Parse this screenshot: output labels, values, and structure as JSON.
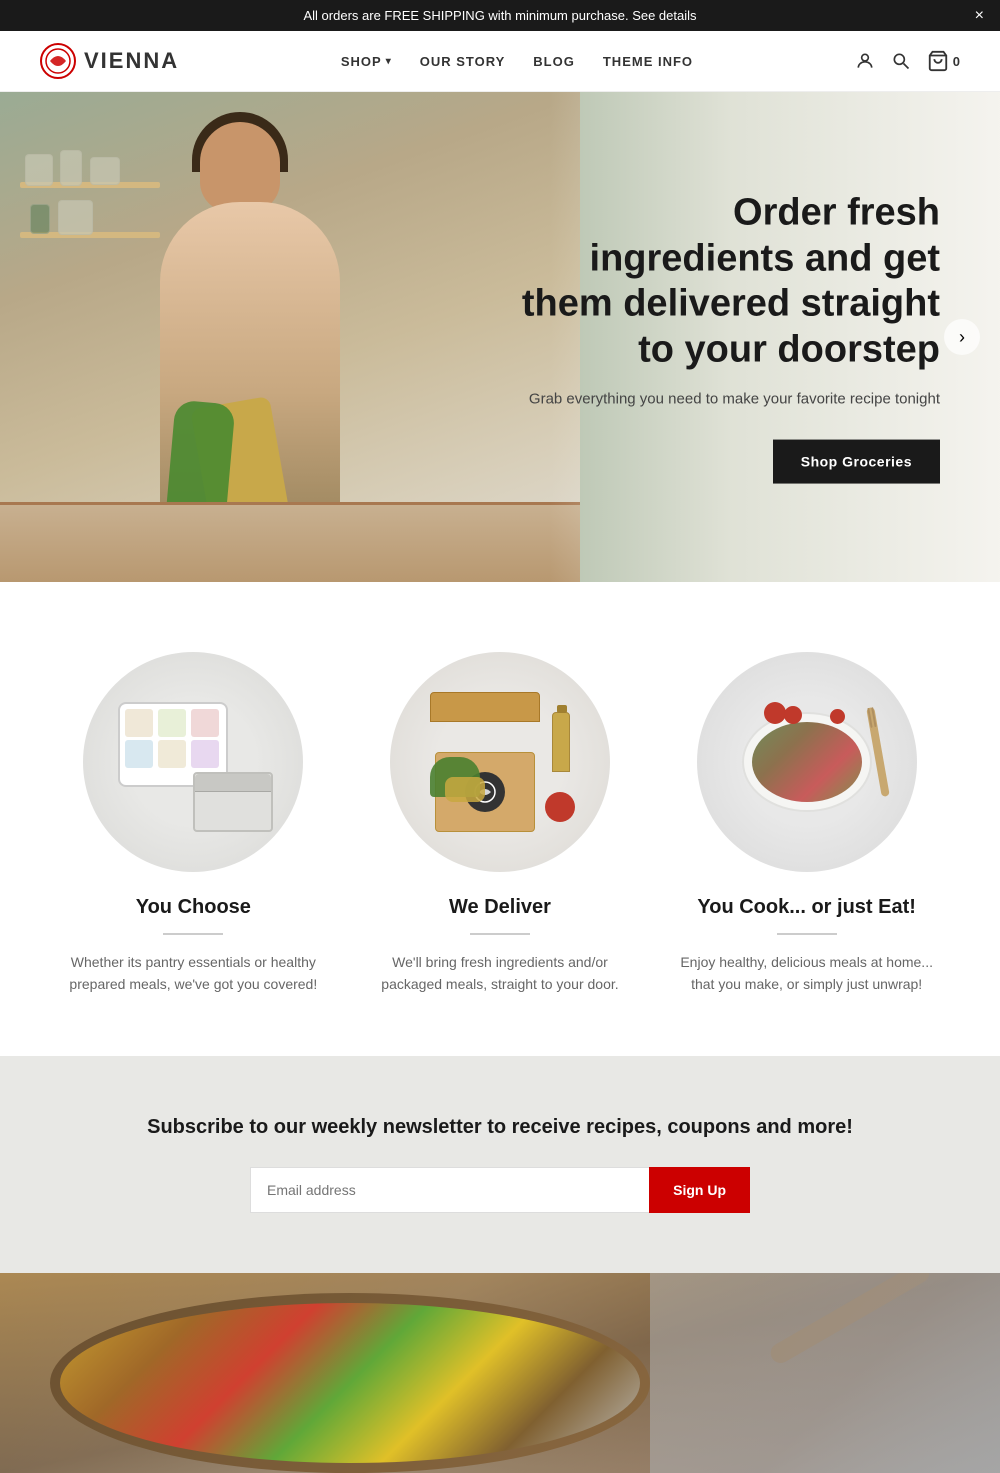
{
  "announcement": {
    "text": "All orders are FREE SHIPPING with minimum purchase. See details",
    "close_label": "×"
  },
  "header": {
    "logo_text": "VIENNA",
    "nav": [
      {
        "label": "SHOP",
        "has_dropdown": true
      },
      {
        "label": "OUR STORY",
        "has_dropdown": false
      },
      {
        "label": "BLOG",
        "has_dropdown": false
      },
      {
        "label": "THEME INFO",
        "has_dropdown": false
      }
    ],
    "cart_label": "0"
  },
  "hero": {
    "title": "Order fresh ingredients and get them delivered straight to your doorstep",
    "subtitle": "Grab everything you need to make your favorite recipe tonight",
    "cta_label": "Shop Groceries"
  },
  "features": [
    {
      "title": "You Choose",
      "description": "Whether its pantry essentials or healthy prepared meals, we've got you covered!"
    },
    {
      "title": "We Deliver",
      "description": "We'll bring fresh ingredients and/or packaged meals, straight to your door."
    },
    {
      "title": "You Cook... or just Eat!",
      "description": "Enjoy healthy, delicious meals at home... that you make, or simply just unwrap!"
    }
  ],
  "newsletter": {
    "title": "Subscribe to our weekly newsletter to receive recipes, coupons and more!",
    "input_placeholder": "Email address",
    "button_label": "Sign Up"
  }
}
